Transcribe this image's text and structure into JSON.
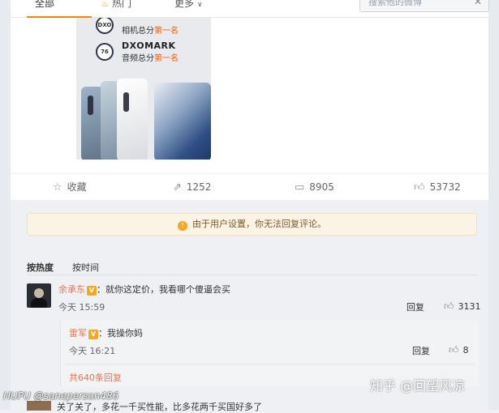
{
  "topbar": {
    "tabs": [
      {
        "label": "全部"
      },
      {
        "label": "热门"
      },
      {
        "label": "更多"
      }
    ],
    "search_placeholder": "搜索他的微博",
    "accent_color": "#ff8200"
  },
  "promo": {
    "rank1_label": "相机总分",
    "rank1_value": "第一名",
    "dxomark": "DXOMARK",
    "rank2_label": "音频总分",
    "rank2_value": "第一名",
    "badge2": "76"
  },
  "actions": {
    "favorite": "收藏",
    "repost": "1252",
    "comment": "8905",
    "like": "53732"
  },
  "notice": "由于用户设置，你无法回复评论。",
  "sort": {
    "hot": "按热度",
    "time": "按时间"
  },
  "comment1": {
    "user": "余承东",
    "text": "：就你这定价，我看哪个傻逼会买",
    "time": "今天 15:59",
    "reply": "回复",
    "likes": "3131"
  },
  "subcomment": {
    "user": "雷军",
    "text": "：我操你妈",
    "time": "今天 16:21",
    "reply": "回复",
    "likes": "8"
  },
  "more_replies": "共640条回复",
  "comment2": {
    "text": "关了关了，多花一千买性能，比多花两千买国好多了"
  },
  "watermarks": {
    "hupu": "HUPU @saneperson486",
    "zhihu": "知乎 @回望风凉"
  }
}
